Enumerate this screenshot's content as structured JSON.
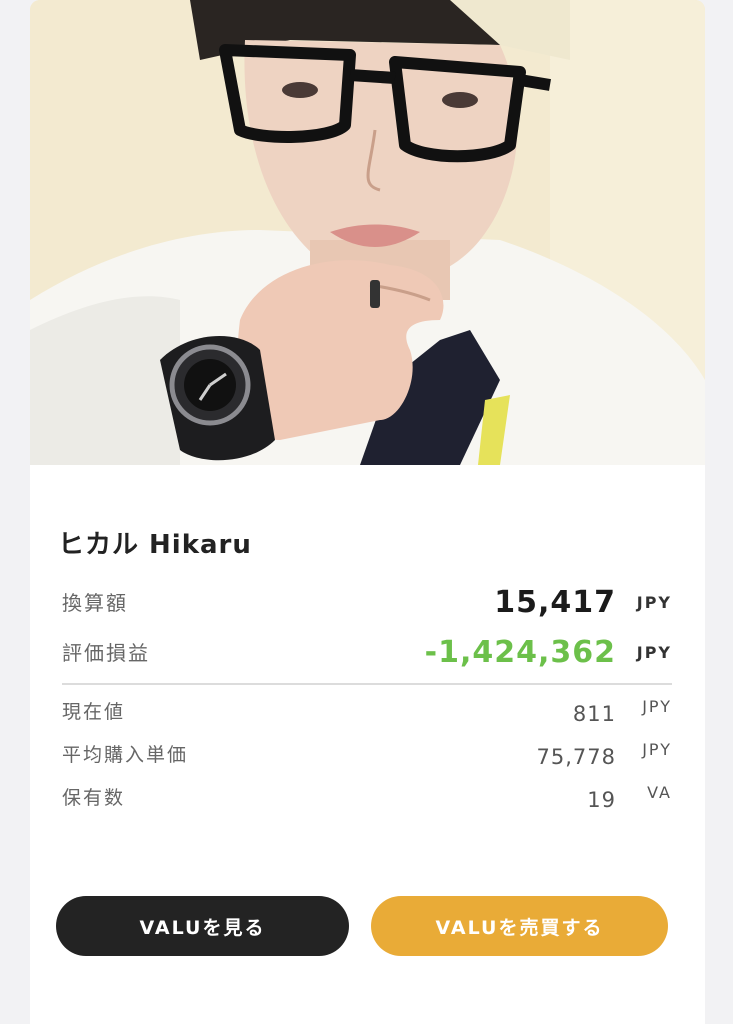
{
  "profile": {
    "name": "ヒカル Hikaru"
  },
  "metrics": {
    "converted_amount": {
      "label": "換算額",
      "value": "15,417",
      "unit": "JPY"
    },
    "unrealized_pl": {
      "label": "評価損益",
      "value": "-1,424,362",
      "unit": "JPY",
      "color": "#6cc04a"
    }
  },
  "details": {
    "current_price": {
      "label": "現在値",
      "value": "811",
      "unit": "JPY"
    },
    "avg_purchase_price": {
      "label": "平均購入単価",
      "value": "75,778",
      "unit": "JPY"
    },
    "holdings": {
      "label": "保有数",
      "value": "19",
      "unit": "VA"
    }
  },
  "actions": {
    "view_label": "VALUを見る",
    "trade_label": "VALUを売買する"
  },
  "colors": {
    "view_button": "#232323",
    "trade_button": "#e9ab37",
    "negative": "#6cc04a"
  }
}
